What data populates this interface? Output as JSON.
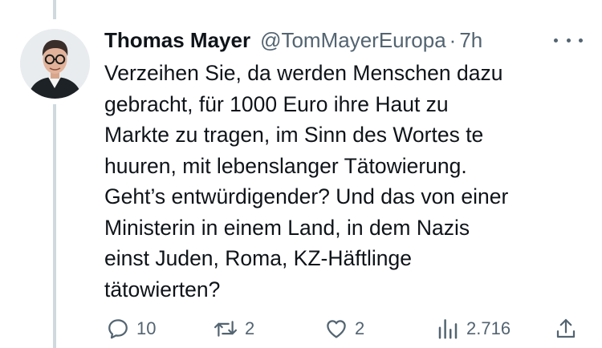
{
  "tweet": {
    "display_name": "Thomas Mayer",
    "handle": "@TomMayerEuropa",
    "separator": "·",
    "time": "7h",
    "text_lines": [
      "Verzeihen Sie, da werden Menschen dazu",
      "gebracht, für 1000 Euro ihre Haut zu",
      "Markte zu tragen, im Sinn des Wortes te",
      "huuren, mit lebenslanger Tätowierung.",
      "Geht’s entwürdigender? Und das von einer",
      "Ministerin in einem Land, in dem Nazis",
      "einst Juden, Roma, KZ-Häftlinge",
      "tätowierten?"
    ]
  },
  "actions": {
    "reply": {
      "icon": "reply-icon",
      "count": "10"
    },
    "retweet": {
      "icon": "retweet-icon",
      "count": "2"
    },
    "like": {
      "icon": "heart-icon",
      "count": "2"
    },
    "views": {
      "icon": "views-chart-icon",
      "count": "2.716"
    },
    "share": {
      "icon": "share-icon"
    },
    "more": {
      "icon": "more-dots-icon"
    }
  },
  "colors": {
    "text": "#0f1419",
    "secondary": "#536471",
    "thread_line": "#cfd9de"
  }
}
